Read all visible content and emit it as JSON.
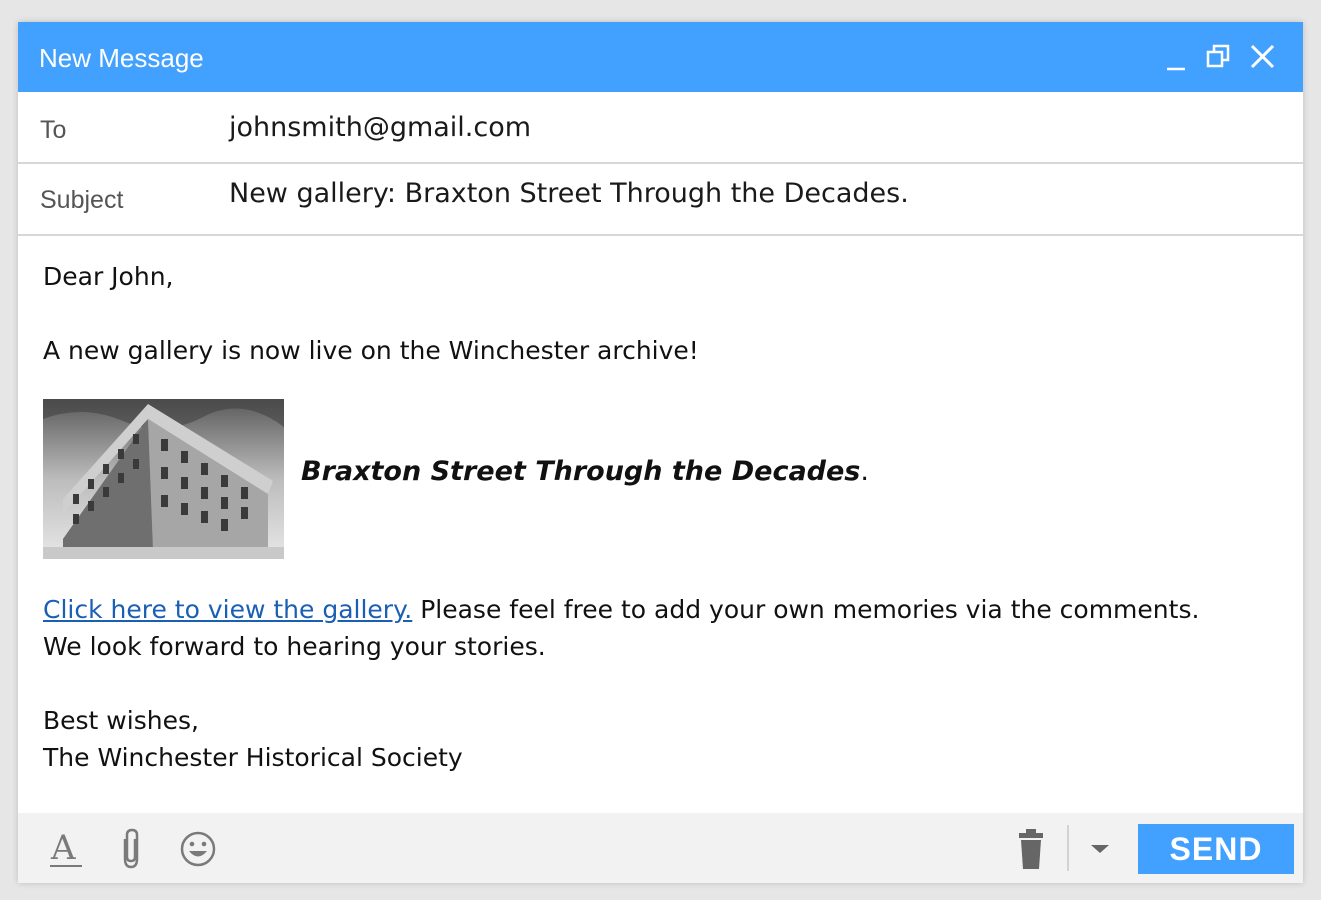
{
  "window": {
    "title": "New Message"
  },
  "fields": {
    "to_label": "To",
    "to_value": "johnsmith@gmail.com",
    "subject_label": "Subject",
    "subject_value": "New gallery: Braxton Street Through the Decades."
  },
  "body": {
    "greeting": "Dear John,",
    "intro": "A new gallery is now live on the Winchester archive!",
    "gallery_title": "Braxton Street Through the Decades",
    "gallery_title_suffix": ".",
    "link_text": "Click here to view the gallery.",
    "after_link": " Please feel free to add your own memories via the comments.",
    "line2": "We look forward to hearing your stories.",
    "signoff": "Best wishes,",
    "signature": "The Winchester Historical Society"
  },
  "toolbar": {
    "send_label": "SEND",
    "icons": [
      "text-format-icon",
      "attachment-icon",
      "emoji-icon",
      "trash-icon",
      "dropdown-arrow-icon"
    ]
  },
  "colors": {
    "accent": "#42a0ff",
    "link": "#1a5fb4",
    "toolbar_bg": "#f2f2f2"
  }
}
